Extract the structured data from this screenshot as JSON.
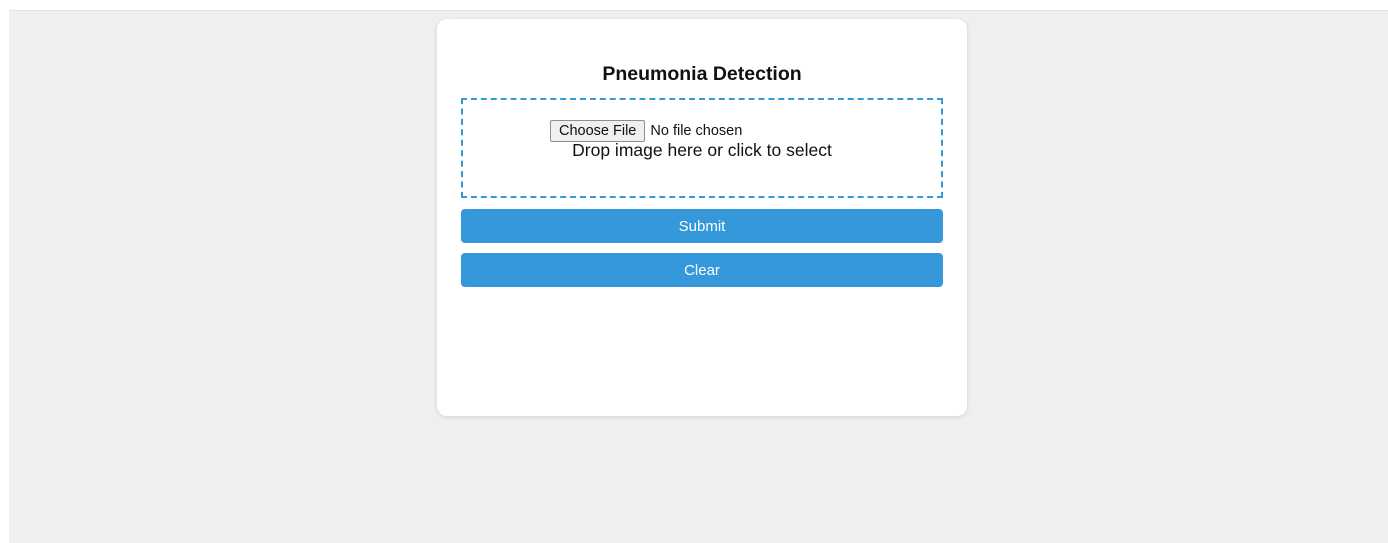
{
  "card": {
    "title": "Pneumonia Detection"
  },
  "upload": {
    "choose_label": "Choose File",
    "file_status": "No file chosen",
    "drop_hint": "Drop image here or click to select"
  },
  "actions": {
    "submit_label": "Submit",
    "clear_label": "Clear"
  },
  "colors": {
    "accent": "#3498db",
    "page_background": "#efefef",
    "card_background": "#ffffff"
  }
}
